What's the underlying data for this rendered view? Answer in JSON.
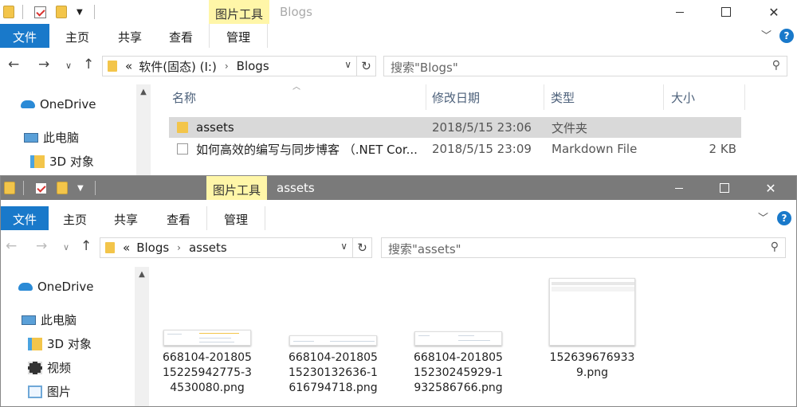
{
  "win1": {
    "title": "Blogs",
    "context_tab": "图片工具",
    "ribbon": {
      "file": "文件",
      "home": "主页",
      "share": "共享",
      "view": "查看",
      "manage": "管理"
    },
    "address": {
      "overflow": "«",
      "crumbs": [
        "软件(固态) (I:)",
        "Blogs"
      ]
    },
    "search_placeholder": "搜索\"Blogs\"",
    "sidebar": [
      "OneDrive",
      "此电脑",
      "3D 对象"
    ],
    "columns": {
      "name": "名称",
      "date": "修改日期",
      "type": "类型",
      "size": "大小"
    },
    "files": [
      {
        "name": "assets",
        "date": "2018/5/15 23:06",
        "type": "文件夹",
        "size": "",
        "icon": "folder-icon"
      },
      {
        "name": "如何高效的编写与同步博客 （.NET Cor...",
        "date": "2018/5/15 23:09",
        "type": "Markdown File",
        "size": "2 KB",
        "icon": "markdown-file-icon"
      }
    ]
  },
  "win2": {
    "title": "assets",
    "context_tab": "图片工具",
    "ribbon": {
      "file": "文件",
      "home": "主页",
      "share": "共享",
      "view": "查看",
      "manage": "管理"
    },
    "address": {
      "overflow": "«",
      "crumbs": [
        "Blogs",
        "assets"
      ]
    },
    "search_placeholder": "搜索\"assets\"",
    "sidebar": [
      "OneDrive",
      "此电脑",
      "3D 对象",
      "视频",
      "图片"
    ],
    "thumbnails": [
      {
        "name": "668104-20180515225942775-34530080.png"
      },
      {
        "name": "668104-20180515230132636-1616794718.png"
      },
      {
        "name": "668104-20180515230245929-1932586766.png"
      },
      {
        "name": "1526396769339.png"
      }
    ]
  },
  "colors": {
    "accent": "#1979ca",
    "context_tab": "#fff6a8",
    "selection": "#d9d9d9",
    "inactive_titlebar": "#7a7a7a"
  }
}
